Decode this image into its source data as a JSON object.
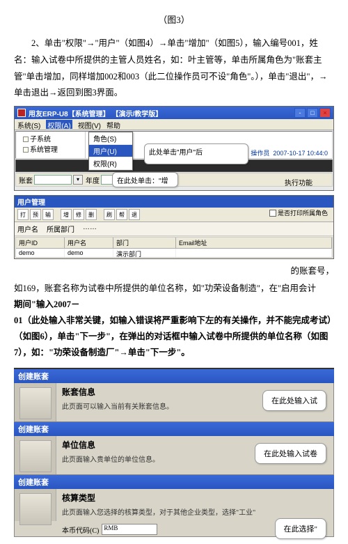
{
  "figLabel": "（图3）",
  "para1": "2、单击\"权限\"→\"用户\"（如图4）→单击\"增加\"（如图5），输入编号001，姓名：输入试卷中所提供的主管人员姓名，如：叶主管等，单击所属角色为\"账套主管\"单击增加，同样增加002和003（此二位操作员可不设\"角色\"。），单击\"退出\"，→单击退出→返回到图3界面。",
  "shot1": {
    "title": "用友ERP-U8【系统管理】 【演示/教学版】",
    "menus": [
      "系统(S)",
      "权限(A)",
      "视图(V)",
      "帮助"
    ],
    "tree": [
      "子系统",
      "系统管理"
    ],
    "popup": [
      "角色(S)",
      "用户(U)",
      "权限(R)"
    ],
    "callout1": "此处单击\"用户\"后",
    "opLabel": "操作员",
    "timestamp": "2007-10-17 10:44:0",
    "tbFields": [
      "账套",
      "年度"
    ],
    "callout2": "在此处单击：\"增",
    "exec": "执行功能"
  },
  "panel2": {
    "title": "用户管理",
    "icons": [
      "打",
      "预",
      "输",
      "增",
      "修",
      "删",
      "刷",
      "帮",
      "退"
    ],
    "chkLabel": "是否打印所属角色",
    "barItems": [
      "用户名",
      "所属部门",
      "……"
    ],
    "gridCols": [
      "用户ID",
      "用户名",
      "部门",
      "Email地址"
    ],
    "gridRow": [
      "demo",
      "demo",
      "演示部门",
      ""
    ]
  },
  "sideNote": "的账套号，",
  "belowLines": [
    "如169，账套名称为试卷中所提供的单位名称，如\"功荣设备制造\"，在\"启用会计",
    "期间\"输入2007－",
    "01（此处输入非常关键，如输入错误将严重影响下左的有关操作，并不能完成考试）（如图6），单击\"下一步\"，在弹出的对话框中输入试卷中所提供的单位名称（如图7），如：\"功荣设备制造厂\"→单击\"下一步\"。"
  ],
  "wiz": {
    "createTitle": "创建账套",
    "sec1": {
      "h": "账套信息",
      "p": "此页面可以输入当前有关账套信息。",
      "callout": "在此处输入试"
    },
    "sec2": {
      "h": "单位信息",
      "p": "此页面输入贵单位的单位信息。",
      "callout": "在此处输入试卷"
    },
    "sec3": {
      "h": "核算类型",
      "p": "此页面输入您选择的核算类型，对于其他企业类型，选择\"工业\"",
      "fieldLabel": "本币代码(C)",
      "fieldValue": "RMB",
      "callout": "在此选择\""
    }
  }
}
